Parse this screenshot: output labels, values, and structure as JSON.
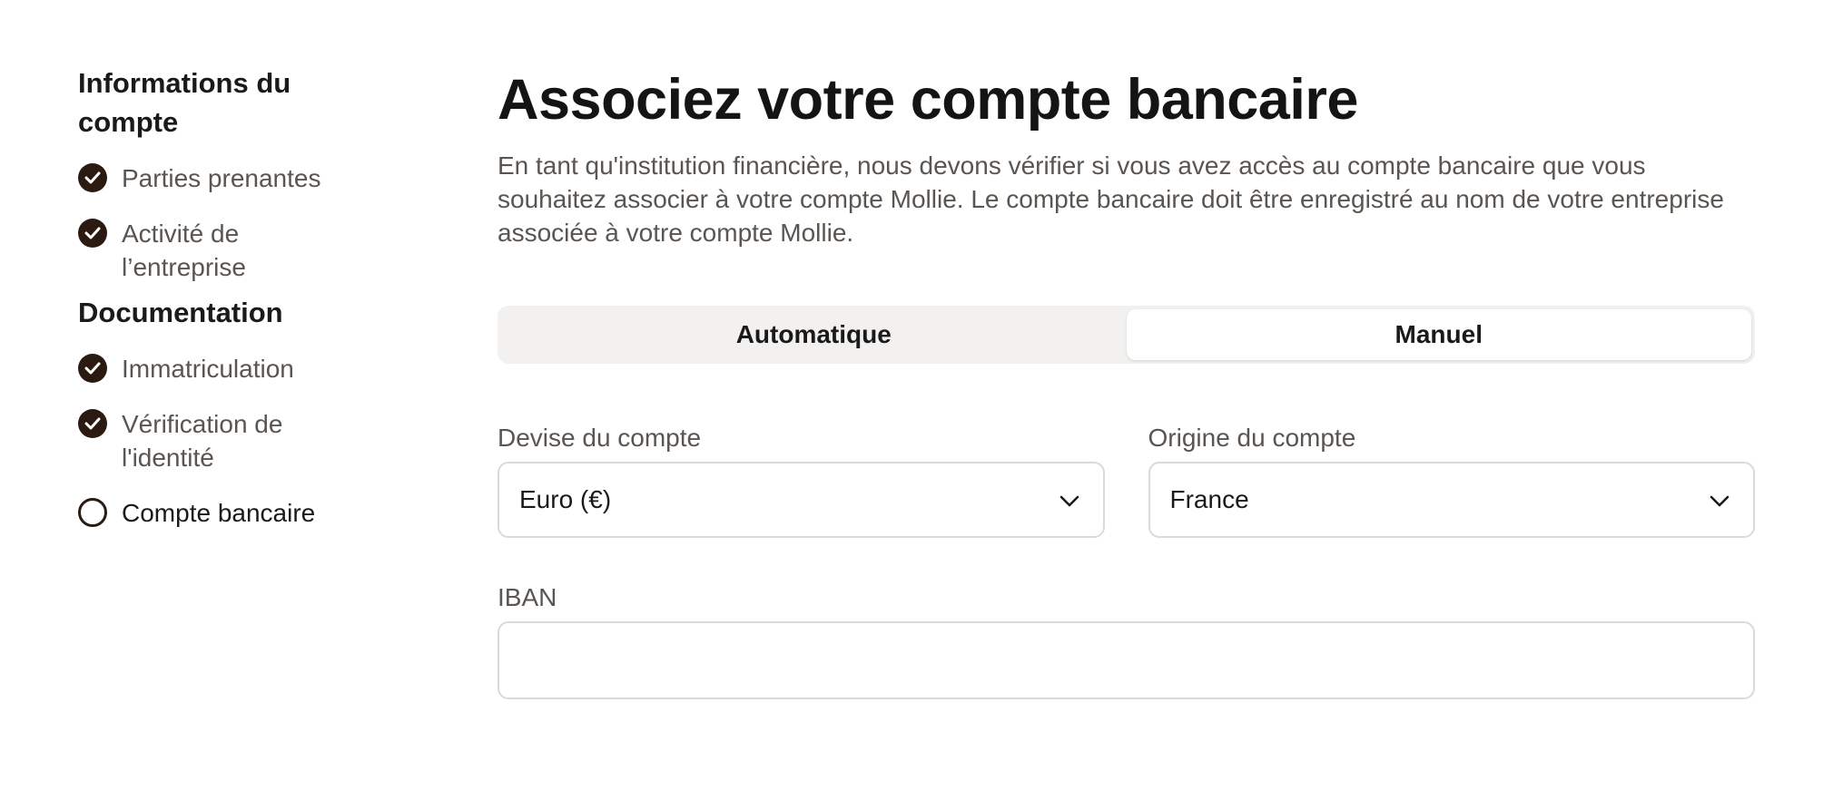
{
  "sidebar": {
    "section_account": "Informations du compte",
    "section_documentation": "Documentation",
    "account_steps": [
      {
        "label": "Parties prenantes",
        "status": "done"
      },
      {
        "label": "Activité de l’entreprise",
        "status": "done"
      }
    ],
    "documentation_steps": [
      {
        "label": "Immatriculation",
        "status": "done"
      },
      {
        "label": "Vérification de l'identité",
        "status": "done"
      },
      {
        "label": "Compte bancaire",
        "status": "current"
      }
    ]
  },
  "main": {
    "title": "Associez votre compte bancaire",
    "intro": "En tant qu'institution financière, nous devons vérifier si vous avez accès au compte bancaire que vous souhaitez associer à votre compte Mollie. Le compte bancaire doit être enregistré au nom de votre entreprise associée à votre compte Mollie.",
    "mode_tabs": [
      {
        "label": "Automatique",
        "selected": false
      },
      {
        "label": "Manuel",
        "selected": true
      }
    ],
    "currency": {
      "label": "Devise du compte",
      "value": "Euro (€)"
    },
    "origin": {
      "label": "Origine du compte",
      "value": "France"
    },
    "iban": {
      "label": "IBAN",
      "value": "",
      "placeholder": ""
    }
  },
  "colors": {
    "check_fill": "#2b1a12",
    "muted_text": "#5a5550",
    "border": "#dcdad7",
    "segment_bg": "#f2f1ef"
  },
  "icons": {
    "done": "check-circle-icon",
    "current": "empty-circle-icon",
    "select": "chevron-down-icon"
  }
}
